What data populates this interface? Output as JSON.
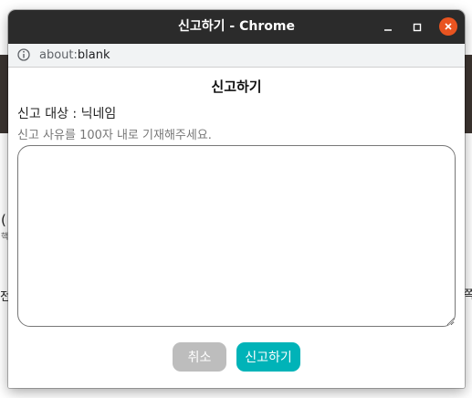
{
  "window": {
    "title": "신고하기 - Chrome",
    "url_prefix": "about:",
    "url_path": "blank"
  },
  "dialog": {
    "heading": "신고하기",
    "target_label": "신고 대상 : ",
    "target_value": "닉네임",
    "reason_hint": "신고 사유를 100자 내로 기재해주세요.",
    "reason_value": ""
  },
  "buttons": {
    "cancel_label": "취소",
    "submit_label": "신고하기"
  },
  "background": {
    "left_char_1": "(",
    "left_char_2": "핵",
    "left_char_3": "전",
    "right_char_1": "쪽"
  },
  "colors": {
    "titlebar": "#2b2b2b",
    "close_button": "#e95420",
    "cancel_button": "#bdbdbd",
    "submit_button": "#00b3b8"
  },
  "icons": {
    "url_info": "info-icon",
    "minimize": "minimize-icon",
    "maximize": "maximize-icon",
    "close": "close-icon"
  }
}
